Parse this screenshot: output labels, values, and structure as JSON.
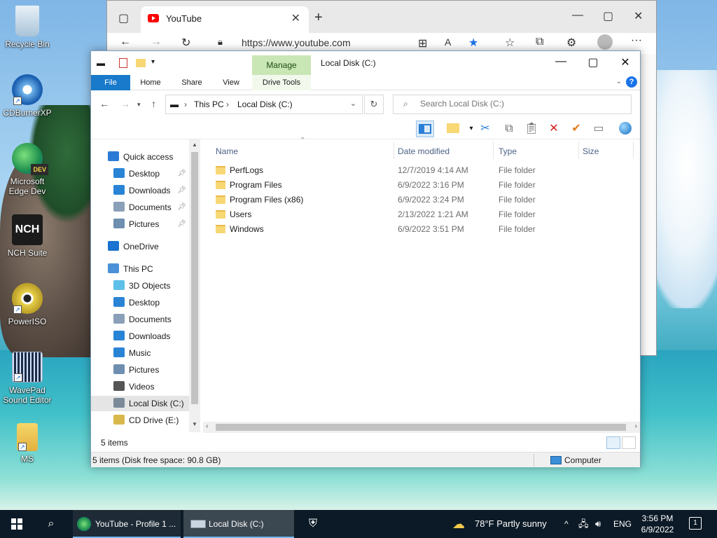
{
  "desktop": {
    "icons": [
      {
        "label": "Recycle Bin"
      },
      {
        "label": "CDBurnerXP"
      },
      {
        "label": "Microsoft Edge Dev",
        "badge": "DEV"
      },
      {
        "label": "NCH Suite",
        "logo": "NCH"
      },
      {
        "label": "PowerISO"
      },
      {
        "label": "WavePad Sound Editor"
      },
      {
        "label": "MS"
      }
    ]
  },
  "browser": {
    "tab_title": "YouTube",
    "url": "https://www.youtube.com"
  },
  "explorer": {
    "window_title": "Local Disk (C:)",
    "ribbon": {
      "manage": "Manage",
      "tabs": [
        "File",
        "Home",
        "Share",
        "View",
        "Drive Tools"
      ]
    },
    "breadcrumb": [
      "This PC",
      "Local Disk (C:)"
    ],
    "search_placeholder": "Search Local Disk (C:)",
    "nav": [
      {
        "label": "Quick access",
        "icon": "star-icon",
        "color": "#2b7bd6",
        "indent": 0,
        "pinned": false
      },
      {
        "label": "Desktop",
        "icon": "desktop-icon",
        "color": "#2a84d6",
        "indent": 1,
        "pinned": true
      },
      {
        "label": "Downloads",
        "icon": "download-icon",
        "color": "#2a84d6",
        "indent": 1,
        "pinned": true
      },
      {
        "label": "Documents",
        "icon": "documents-icon",
        "color": "#8aa0b8",
        "indent": 1,
        "pinned": true
      },
      {
        "label": "Pictures",
        "icon": "pictures-icon",
        "color": "#6e8fb0",
        "indent": 1,
        "pinned": true
      },
      {
        "label": "OneDrive",
        "icon": "cloud-icon",
        "color": "#1a73d0",
        "indent": 0,
        "pinned": false
      },
      {
        "label": "This PC",
        "icon": "computer-icon",
        "color": "#4a90d9",
        "indent": 0,
        "pinned": false
      },
      {
        "label": "3D Objects",
        "icon": "cube-icon",
        "color": "#5ec0e8",
        "indent": 1,
        "pinned": false
      },
      {
        "label": "Desktop",
        "icon": "desktop-icon",
        "color": "#2a84d6",
        "indent": 1,
        "pinned": false
      },
      {
        "label": "Documents",
        "icon": "documents-icon",
        "color": "#8aa0b8",
        "indent": 1,
        "pinned": false
      },
      {
        "label": "Downloads",
        "icon": "download-icon",
        "color": "#2a84d6",
        "indent": 1,
        "pinned": false
      },
      {
        "label": "Music",
        "icon": "music-icon",
        "color": "#2a84d6",
        "indent": 1,
        "pinned": false
      },
      {
        "label": "Pictures",
        "icon": "pictures-icon",
        "color": "#6e8fb0",
        "indent": 1,
        "pinned": false
      },
      {
        "label": "Videos",
        "icon": "video-icon",
        "color": "#555555",
        "indent": 1,
        "pinned": false
      },
      {
        "label": "Local Disk (C:)",
        "icon": "drive-icon",
        "color": "#7a8a99",
        "indent": 1,
        "pinned": false,
        "selected": true
      },
      {
        "label": "CD Drive (E:)",
        "icon": "cd-icon",
        "color": "#d8b84a",
        "indent": 1,
        "pinned": false
      }
    ],
    "columns": [
      "Name",
      "Date modified",
      "Type",
      "Size"
    ],
    "files": [
      {
        "name": "PerfLogs",
        "date": "12/7/2019 4:14 AM",
        "type": "File folder"
      },
      {
        "name": "Program Files",
        "date": "6/9/2022 3:16 PM",
        "type": "File folder"
      },
      {
        "name": "Program Files (x86)",
        "date": "6/9/2022 3:24 PM",
        "type": "File folder"
      },
      {
        "name": "Users",
        "date": "2/13/2022 1:21 AM",
        "type": "File folder"
      },
      {
        "name": "Windows",
        "date": "6/9/2022 3:51 PM",
        "type": "File folder"
      }
    ],
    "item_count": "5 items",
    "status_info": "5 items (Disk free space: 90.8 GB)",
    "status_location": "Computer"
  },
  "taskbar": {
    "apps": [
      {
        "label": "YouTube - Profile 1 ..."
      },
      {
        "label": "Local Disk (C:)"
      }
    ],
    "weather": "78°F  Partly sunny",
    "language": "ENG",
    "time": "3:56 PM",
    "date": "6/9/2022",
    "notifications": "1"
  },
  "colors": {
    "accent": "#1979ca",
    "manage_tab": "#c9e6b5",
    "folder": "#f8d775",
    "taskbar": "#0b1a26"
  }
}
